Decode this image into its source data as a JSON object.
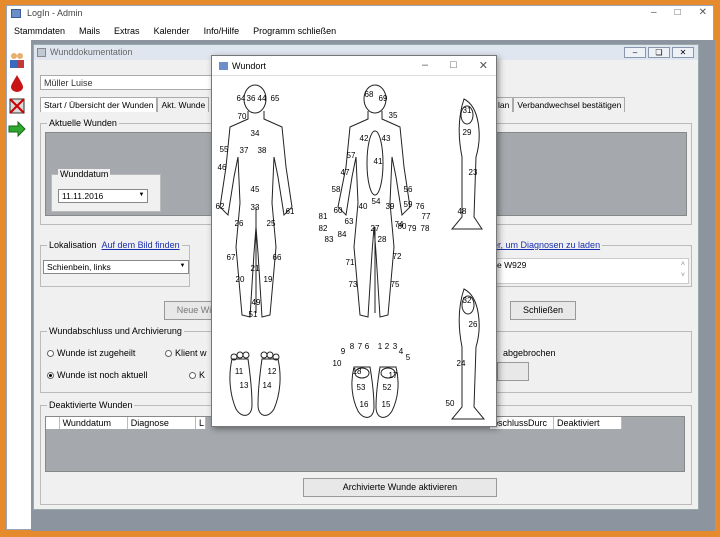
{
  "app": {
    "title": "LogIn - Admin"
  },
  "menu": [
    "Stammdaten",
    "Mails",
    "Extras",
    "Kalender",
    "Info/Hilfe",
    "Programm schließen"
  ],
  "child": {
    "title": "Wunddokumentation",
    "patient": "Müller Luise",
    "tabs": [
      "Start / Übersicht der Wunden",
      "Akt. Wunde"
    ],
    "tabs_right": [
      "lan",
      "Verbandwechsel bestätigen"
    ],
    "current_wounds_label": "Aktuelle Wunden",
    "wound_date_label": "Wunddatum",
    "wound_date_value": "11.11.2016",
    "localisation_label": "Lokalisation",
    "localisation_link": "Auf dem Bild finden",
    "localisation_value": "Schienbein, links",
    "diagnosis_link": "er, um Diagnosen zu laden",
    "diagnosis_value": "e W929",
    "new_button": "Neue Wi",
    "close_button": "Schließen",
    "closure_label": "Wundabschluss und Archivierung",
    "radio_healed": "Wunde ist zugeheilt",
    "radio_client": "Klient w",
    "radio_not_current": "Wunde ist noch aktuell",
    "radio_k": "K",
    "aborted": "abgebrochen",
    "deactivated_label": "Deaktivierte Wunden",
    "grid_columns": [
      "Wunddatum",
      "Diagnose",
      "L",
      "bschlussDurc",
      "Deaktiviert"
    ],
    "activate_button": "Archivierte Wunde aktivieren"
  },
  "dialog": {
    "title": "Wundort",
    "labels": {
      "back": [
        "64",
        "36",
        "44",
        "65",
        "70",
        "34",
        "55",
        "37",
        "38",
        "46",
        "45",
        "33",
        "62",
        "61",
        "26",
        "25",
        "67",
        "21",
        "66",
        "20",
        "19",
        "49",
        "51"
      ],
      "front": [
        "68",
        "69",
        "35",
        "42",
        "43",
        "57",
        "41",
        "47",
        "58",
        "56",
        "54",
        "40",
        "39",
        "60",
        "59",
        "76",
        "77",
        "81",
        "82",
        "63",
        "83",
        "84",
        "27",
        "28",
        "74",
        "79",
        "78",
        "71",
        "72",
        "73",
        "75",
        "80"
      ],
      "side_top": [
        "31",
        "29",
        "23",
        "48"
      ],
      "side_bottom": [
        "32",
        "26",
        "24",
        "50"
      ],
      "feet_left": [
        "11",
        "12",
        "13",
        "14"
      ],
      "feet_right": [
        "9",
        "8",
        "7",
        "6",
        "1",
        "2",
        "3",
        "4",
        "5",
        "10",
        "18",
        "17",
        "53",
        "52",
        "16",
        "15"
      ]
    }
  },
  "colors": {
    "background": "#e68a2e",
    "mdi": "#8c94a0",
    "gray": "#a5a9ad",
    "link": "#1a2fb0"
  }
}
